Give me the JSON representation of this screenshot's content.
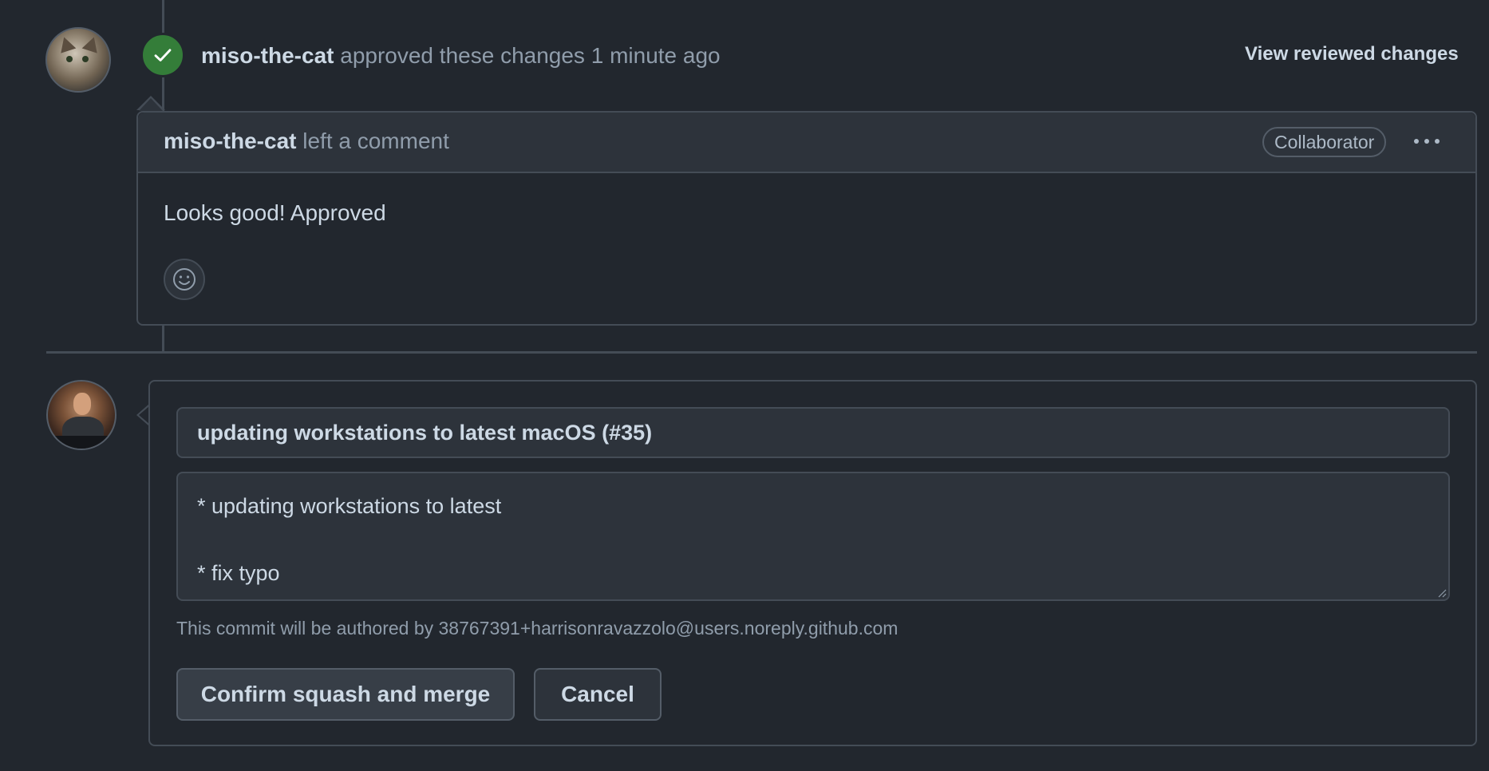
{
  "review": {
    "author": "miso-the-cat",
    "action": "approved these changes",
    "time": "1 minute ago",
    "view_changes_label": "View reviewed changes"
  },
  "comment": {
    "author": "miso-the-cat",
    "action": "left a comment",
    "badge": "Collaborator",
    "more_label": "•••",
    "body": "Looks good! Approved"
  },
  "merge": {
    "commit_title": "updating workstations to latest macOS (#35)",
    "commit_message": "* updating workstations to latest\n\n* fix typo",
    "author_note": "This commit will be authored by 38767391+harrisonravazzolo@users.noreply.github.com",
    "confirm_label": "Confirm squash and merge",
    "cancel_label": "Cancel"
  },
  "colors": {
    "background": "#22272e",
    "approved_green": "#347d39",
    "border": "#444c56"
  },
  "icons": {
    "approved": "check-icon",
    "reaction": "smiley-icon",
    "more": "kebab-horizontal-icon"
  }
}
